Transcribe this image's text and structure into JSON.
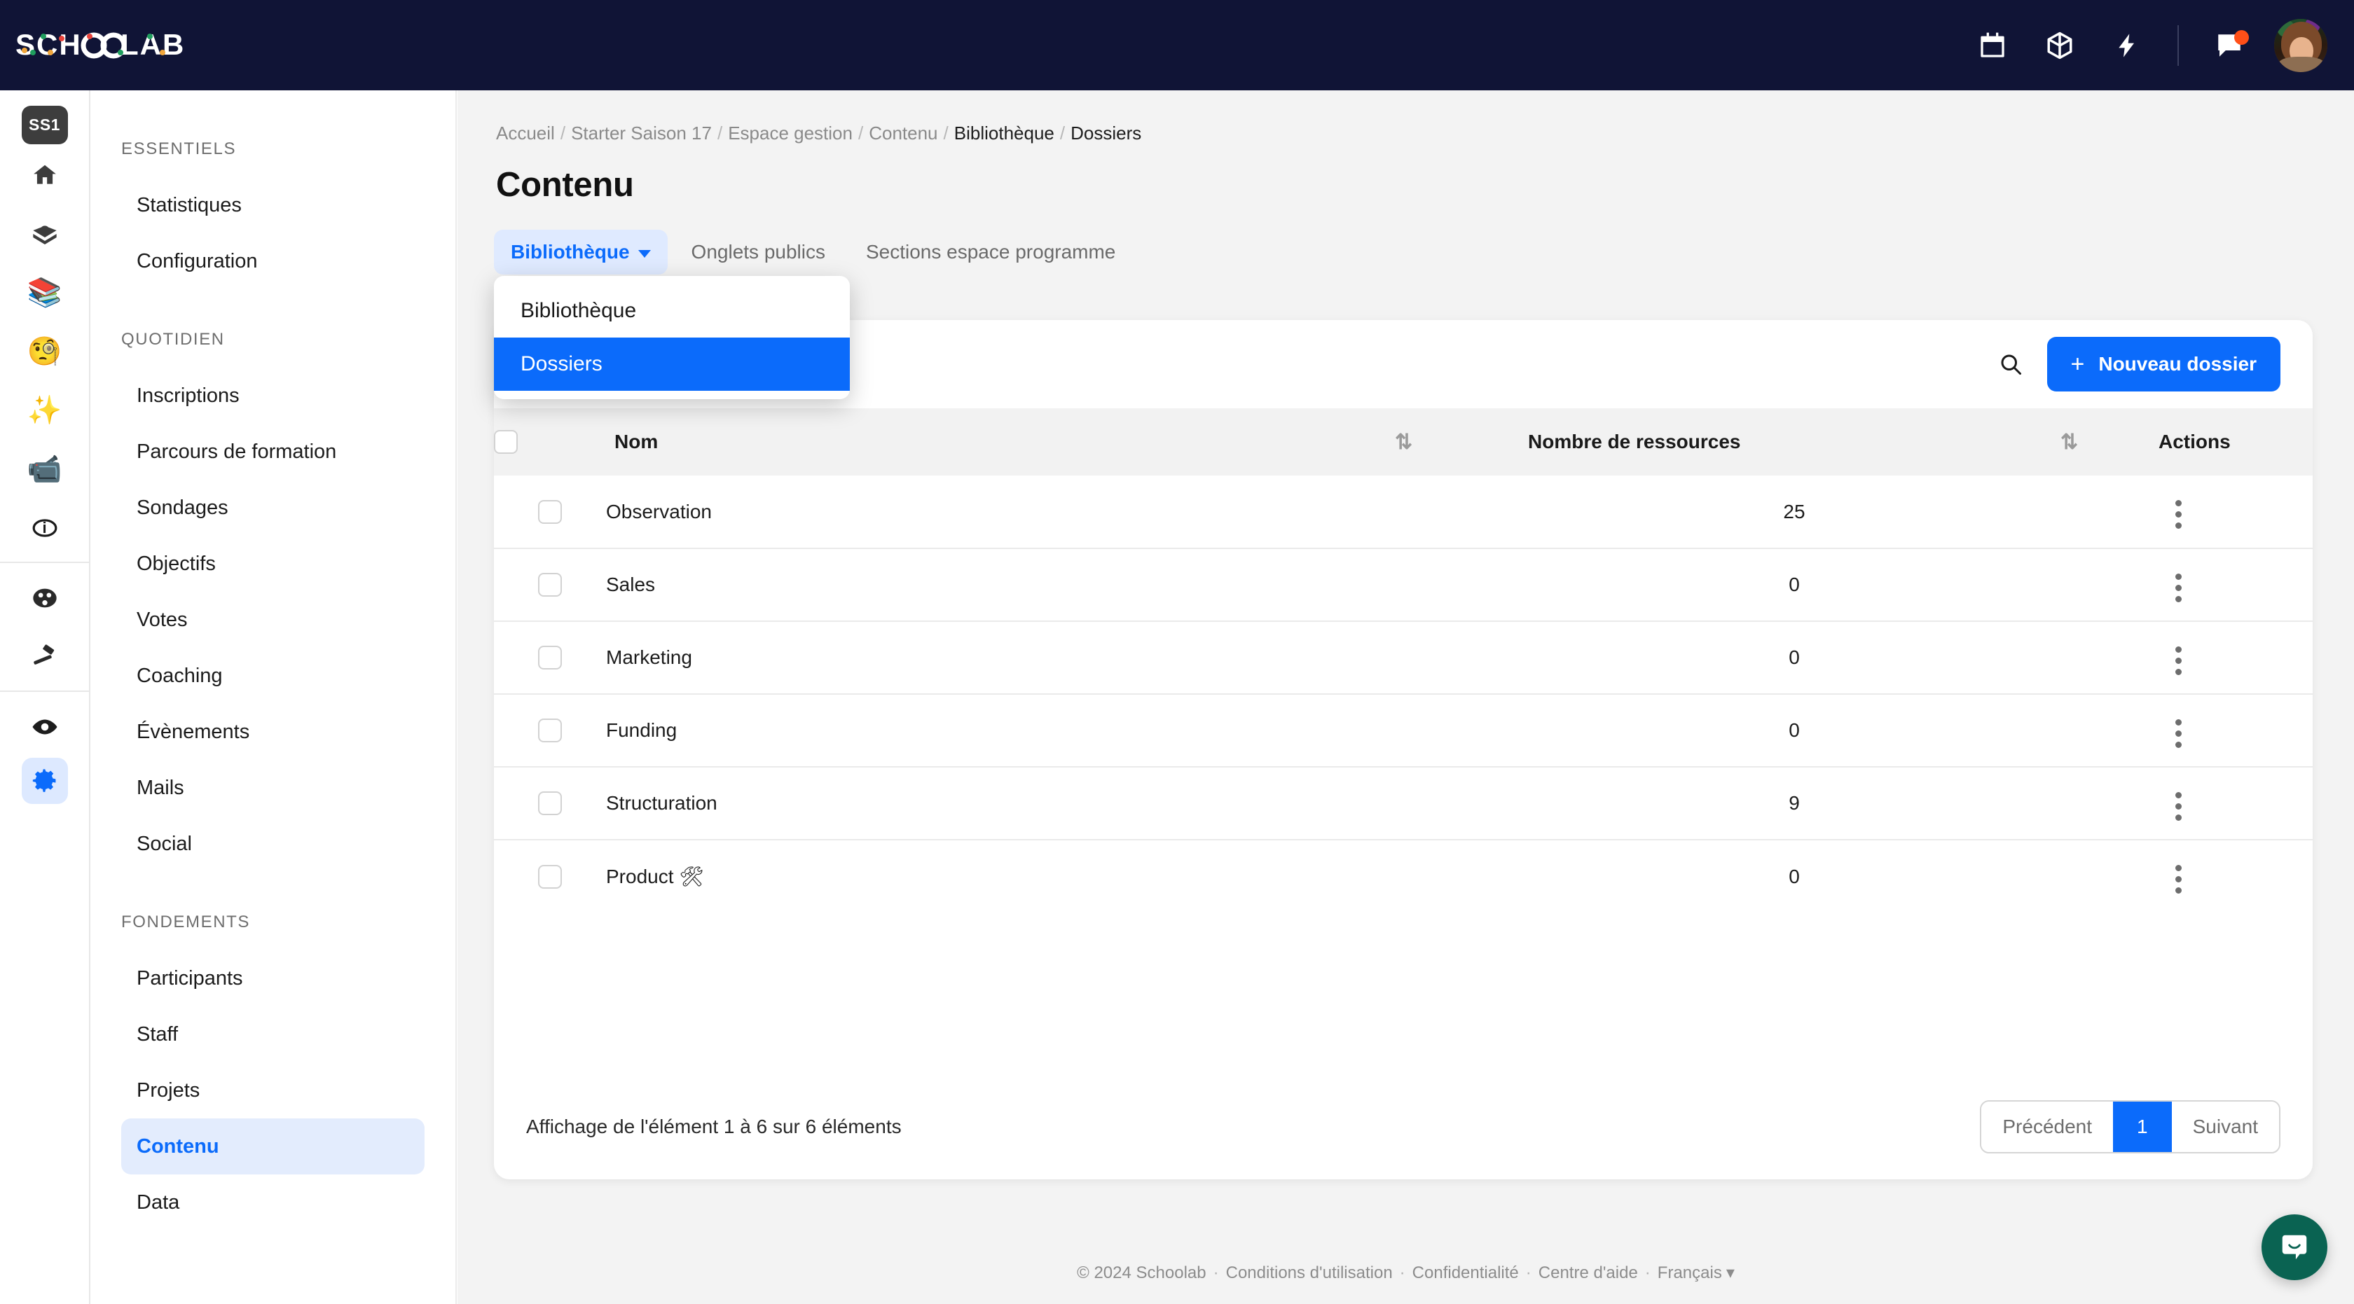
{
  "topbar": {
    "brand": "SCHOOLAB",
    "icons": [
      {
        "name": "calendar-icon",
        "label": "Calendrier"
      },
      {
        "name": "box-icon",
        "label": "Ressources"
      },
      {
        "name": "lightning-icon",
        "label": "Actions rapides"
      },
      {
        "name": "chat-icon",
        "label": "Messages",
        "badge": true
      }
    ],
    "avatar_label": "Profil",
    "notification_color": "#ff4f18",
    "background_color": "#101436"
  },
  "rail": {
    "badge": "SS1",
    "icons": [
      {
        "name": "home-icon",
        "glyph": "🏠"
      },
      {
        "name": "open-book-icon",
        "glyph": "📖"
      },
      {
        "name": "books-icon",
        "glyph": "📚"
      },
      {
        "name": "monocle-face-icon",
        "glyph": "🧐"
      },
      {
        "name": "sparkles-icon",
        "glyph": "✨"
      },
      {
        "name": "video-camera-icon",
        "glyph": "📹"
      },
      {
        "name": "info-circle-icon",
        "glyph": "ℹ"
      }
    ],
    "icons_group2": [
      {
        "name": "people-icon",
        "glyph": "👥"
      },
      {
        "name": "gavel-icon",
        "glyph": "⚖"
      }
    ],
    "icons_group3": [
      {
        "name": "eye-icon",
        "glyph": "👁"
      },
      {
        "name": "gear-icon",
        "glyph": "⚙",
        "active": true
      }
    ]
  },
  "sidebar": {
    "sections": [
      {
        "title": "ESSENTIELS",
        "items": [
          {
            "label": "Statistiques",
            "active": false
          },
          {
            "label": "Configuration",
            "active": false
          }
        ]
      },
      {
        "title": "QUOTIDIEN",
        "items": [
          {
            "label": "Inscriptions",
            "active": false
          },
          {
            "label": "Parcours de formation",
            "active": false
          },
          {
            "label": "Sondages",
            "active": false
          },
          {
            "label": "Objectifs",
            "active": false
          },
          {
            "label": "Votes",
            "active": false
          },
          {
            "label": "Coaching",
            "active": false
          },
          {
            "label": "Évènements",
            "active": false
          },
          {
            "label": "Mails",
            "active": false
          },
          {
            "label": "Social",
            "active": false
          }
        ]
      },
      {
        "title": "FONDEMENTS",
        "items": [
          {
            "label": "Participants",
            "active": false
          },
          {
            "label": "Staff",
            "active": false
          },
          {
            "label": "Projets",
            "active": false
          },
          {
            "label": "Contenu",
            "active": true
          },
          {
            "label": "Data",
            "active": false
          }
        ]
      }
    ]
  },
  "breadcrumb": [
    {
      "label": "Accueil",
      "strong": false
    },
    {
      "label": "Starter Saison 17",
      "strong": false
    },
    {
      "label": "Espace gestion",
      "strong": false
    },
    {
      "label": "Contenu",
      "strong": false
    },
    {
      "label": "Bibliothèque",
      "strong": true
    },
    {
      "label": "Dossiers",
      "strong": true
    }
  ],
  "page": {
    "title": "Contenu"
  },
  "tabs": [
    {
      "label": "Bibliothèque",
      "active": true,
      "has_caret": true
    },
    {
      "label": "Onglets publics",
      "active": false,
      "has_caret": false
    },
    {
      "label": "Sections espace programme",
      "active": false,
      "has_caret": false
    }
  ],
  "dropdown": {
    "open": true,
    "items": [
      {
        "label": "Bibliothèque",
        "selected": false
      },
      {
        "label": "Dossiers",
        "selected": true
      }
    ]
  },
  "toolbar": {
    "search_icon": "search-icon",
    "new_button_label": "Nouveau dossier",
    "new_button_plus": "+",
    "accent_color": "#0b6bfb"
  },
  "table": {
    "columns": [
      "Nom",
      "Nombre de ressources",
      "Actions"
    ],
    "rows": [
      {
        "name": "Observation",
        "count": "25"
      },
      {
        "name": "Sales",
        "count": "0"
      },
      {
        "name": "Marketing",
        "count": "0"
      },
      {
        "name": "Funding",
        "count": "0"
      },
      {
        "name": "Structuration",
        "count": "9"
      },
      {
        "name": "Product 🛠",
        "count": "0"
      }
    ]
  },
  "pagination": {
    "showing": "Affichage de l'élément 1 à 6 sur 6 éléments",
    "previous": "Précédent",
    "current_page": "1",
    "next": "Suivant"
  },
  "footer": {
    "copyright": "© 2024 Schoolab",
    "links": [
      "Conditions d'utilisation",
      "Confidentialité",
      "Centre d'aide"
    ],
    "language": "Français"
  },
  "intercom": {
    "color": "#0a6352",
    "label": "Ouvrir le chat"
  }
}
